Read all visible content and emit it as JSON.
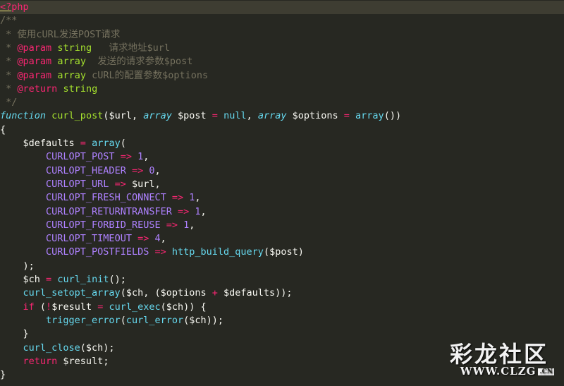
{
  "editor": {
    "theme_colors": {
      "background": "#272822",
      "current_line": "#3e3d32",
      "keyword": "#66d9ef",
      "function": "#a6e22e",
      "operator": "#f92672",
      "constant": "#ae81ff",
      "comment": "#75715e"
    },
    "lines": [
      [
        [
          "tag",
          "<?"
        ],
        [
          "php",
          "php"
        ]
      ],
      [
        [
          "comment",
          "/**"
        ]
      ],
      [
        [
          "comment",
          " * 使用cURL发送POST请求"
        ]
      ],
      [
        [
          "comment",
          " * "
        ],
        [
          "doctag",
          "@param"
        ],
        [
          "plain",
          " "
        ],
        [
          "doctype",
          "string"
        ],
        [
          "comment",
          "   请求地址$url"
        ]
      ],
      [
        [
          "comment",
          " * "
        ],
        [
          "doctag",
          "@param"
        ],
        [
          "plain",
          " "
        ],
        [
          "doctype",
          "array"
        ],
        [
          "comment",
          "  发送的请求参数$post"
        ]
      ],
      [
        [
          "comment",
          " * "
        ],
        [
          "doctag",
          "@param"
        ],
        [
          "plain",
          " "
        ],
        [
          "doctype",
          "array"
        ],
        [
          "comment",
          " cURL的配置参数$options"
        ]
      ],
      [
        [
          "comment",
          " * "
        ],
        [
          "doctag",
          "@return"
        ],
        [
          "plain",
          " "
        ],
        [
          "doctype",
          "string"
        ]
      ],
      [
        [
          "comment",
          " */"
        ]
      ],
      [
        [
          "keyword",
          "function"
        ],
        [
          "plain",
          " "
        ],
        [
          "fn",
          "curl_post"
        ],
        [
          "plain",
          "($url, "
        ],
        [
          "keyword",
          "array"
        ],
        [
          "plain",
          " $post "
        ],
        [
          "op",
          "="
        ],
        [
          "plain",
          " "
        ],
        [
          "builtin",
          "null"
        ],
        [
          "plain",
          ", "
        ],
        [
          "keyword",
          "array"
        ],
        [
          "plain",
          " $options "
        ],
        [
          "op",
          "="
        ],
        [
          "plain",
          " "
        ],
        [
          "builtin",
          "array"
        ],
        [
          "plain",
          "())"
        ]
      ],
      [
        [
          "plain",
          "{"
        ]
      ],
      [
        [
          "plain",
          "    $defaults "
        ],
        [
          "op",
          "="
        ],
        [
          "plain",
          " "
        ],
        [
          "builtin",
          "array"
        ],
        [
          "plain",
          "("
        ]
      ],
      [
        [
          "plain",
          "        "
        ],
        [
          "const",
          "CURLOPT_POST"
        ],
        [
          "plain",
          " "
        ],
        [
          "op",
          "=>"
        ],
        [
          "plain",
          " "
        ],
        [
          "num",
          "1"
        ],
        [
          "plain",
          ","
        ]
      ],
      [
        [
          "plain",
          "        "
        ],
        [
          "const",
          "CURLOPT_HEADER"
        ],
        [
          "plain",
          " "
        ],
        [
          "op",
          "=>"
        ],
        [
          "plain",
          " "
        ],
        [
          "num",
          "0"
        ],
        [
          "plain",
          ","
        ]
      ],
      [
        [
          "plain",
          "        "
        ],
        [
          "const",
          "CURLOPT_URL"
        ],
        [
          "plain",
          " "
        ],
        [
          "op",
          "=>"
        ],
        [
          "plain",
          " $url,"
        ]
      ],
      [
        [
          "plain",
          "        "
        ],
        [
          "const",
          "CURLOPT_FRESH_CONNECT"
        ],
        [
          "plain",
          " "
        ],
        [
          "op",
          "=>"
        ],
        [
          "plain",
          " "
        ],
        [
          "num",
          "1"
        ],
        [
          "plain",
          ","
        ]
      ],
      [
        [
          "plain",
          "        "
        ],
        [
          "const",
          "CURLOPT_RETURNTRANSFER"
        ],
        [
          "plain",
          " "
        ],
        [
          "op",
          "=>"
        ],
        [
          "plain",
          " "
        ],
        [
          "num",
          "1"
        ],
        [
          "plain",
          ","
        ]
      ],
      [
        [
          "plain",
          "        "
        ],
        [
          "const",
          "CURLOPT_FORBID_REUSE"
        ],
        [
          "plain",
          " "
        ],
        [
          "op",
          "=>"
        ],
        [
          "plain",
          " "
        ],
        [
          "num",
          "1"
        ],
        [
          "plain",
          ","
        ]
      ],
      [
        [
          "plain",
          "        "
        ],
        [
          "const",
          "CURLOPT_TIMEOUT"
        ],
        [
          "plain",
          " "
        ],
        [
          "op",
          "=>"
        ],
        [
          "plain",
          " "
        ],
        [
          "num",
          "4"
        ],
        [
          "plain",
          ","
        ]
      ],
      [
        [
          "plain",
          "        "
        ],
        [
          "const",
          "CURLOPT_POSTFIELDS"
        ],
        [
          "plain",
          " "
        ],
        [
          "op",
          "=>"
        ],
        [
          "plain",
          " "
        ],
        [
          "builtin",
          "http_build_query"
        ],
        [
          "plain",
          "($post)"
        ]
      ],
      [
        [
          "plain",
          "    );"
        ]
      ],
      [
        [
          "plain",
          "    $ch "
        ],
        [
          "op",
          "="
        ],
        [
          "plain",
          " "
        ],
        [
          "builtin",
          "curl_init"
        ],
        [
          "plain",
          "();"
        ]
      ],
      [
        [
          "plain",
          "    "
        ],
        [
          "builtin",
          "curl_setopt_array"
        ],
        [
          "plain",
          "($ch, ($options "
        ],
        [
          "op",
          "+"
        ],
        [
          "plain",
          " $defaults));"
        ]
      ],
      [
        [
          "plain",
          "    "
        ],
        [
          "kw2",
          "if"
        ],
        [
          "plain",
          " ("
        ],
        [
          "op",
          "!"
        ],
        [
          "plain",
          "$result "
        ],
        [
          "op",
          "="
        ],
        [
          "plain",
          " "
        ],
        [
          "builtin",
          "curl_exec"
        ],
        [
          "plain",
          "($ch)) {"
        ]
      ],
      [
        [
          "plain",
          "        "
        ],
        [
          "builtin",
          "trigger_error"
        ],
        [
          "plain",
          "("
        ],
        [
          "builtin",
          "curl_error"
        ],
        [
          "plain",
          "($ch));"
        ]
      ],
      [
        [
          "plain",
          "    }"
        ]
      ],
      [
        [
          "plain",
          "    "
        ],
        [
          "builtin",
          "curl_close"
        ],
        [
          "plain",
          "($ch);"
        ]
      ],
      [
        [
          "plain",
          "    "
        ],
        [
          "kw2",
          "return"
        ],
        [
          "plain",
          " $result;"
        ]
      ],
      [
        [
          "plain",
          "}"
        ]
      ]
    ]
  },
  "watermark": {
    "mark_text": "彩龙社区",
    "url_text": "WWW.CLZG",
    "badge_text": ".CN"
  }
}
